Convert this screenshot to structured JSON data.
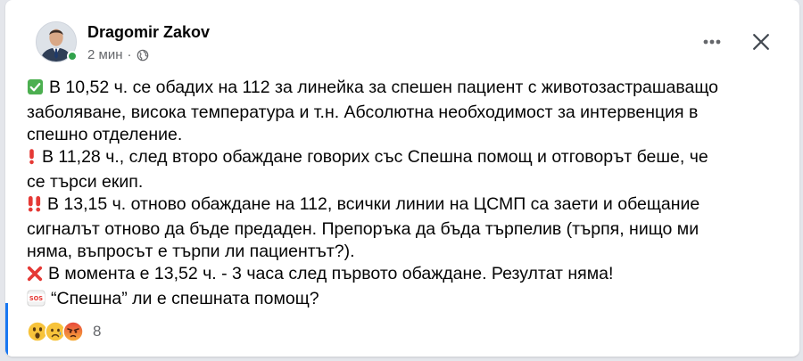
{
  "post": {
    "author": "Dragomir Zakov",
    "time": "2 мин",
    "separator": "·",
    "audience_icon": "globe-icon",
    "lines": {
      "p1a": "В 10,52 ч. се обадих на 112 за линейка за спешен пациент с животозастрашаващо",
      "p1b": "заболяване, висока температура и т.н. Абсолютна необходимост за интервенция в",
      "p1c": "спешно отделение.",
      "p2a": "В 11,28 ч., след второ обаждане говорих със Спешна помощ и отговорът беше, че",
      "p2b": "се търси екип.",
      "p3a": "В 13,15 ч. отново обаждане на 112, всички линии на ЦСМП са заети и обещание",
      "p3b": "сигналът отново да бъде предаден. Препоръка да бъда търпелив (търпя, нищо ми",
      "p3c": "няма, въпросът е търпи ли пациентът?).",
      "p4a": "В момента е 13,52 ч. - 3 часа след първото обаждане. Резултат няма!",
      "p5a": "“Спешна” ли е спешната помощ?"
    },
    "emoji_icons": [
      "check-mark-icon",
      "exclamation-icon",
      "double-exclamation-icon",
      "cross-mark-icon",
      "sos-icon"
    ],
    "reactions": {
      "icons": [
        "wow-reaction-icon",
        "sad-reaction-icon",
        "angry-reaction-icon"
      ],
      "count": "8"
    }
  },
  "colors": {
    "online": "#31a24c",
    "check": "#4caf50",
    "red": "#e53935",
    "accent": "#1877f2",
    "meta_text": "#65676b"
  }
}
